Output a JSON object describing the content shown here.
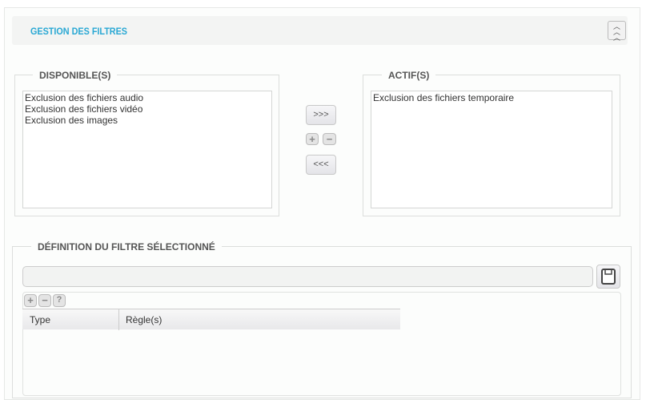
{
  "header": {
    "title": "GESTION DES FILTRES",
    "collapse_icon": "double-chevron-up-icon"
  },
  "available": {
    "legend": "DISPONIBLE(S)",
    "items": [
      "Exclusion des fichiers audio",
      "Exclusion des fichiers vidéo",
      "Exclusion des images"
    ]
  },
  "active": {
    "legend": "ACTIF(S)",
    "items": [
      "Exclusion des fichiers temporaire"
    ]
  },
  "transfer": {
    "add_label": ">>>",
    "remove_label": "<<<",
    "plus": "+",
    "minus": "−"
  },
  "definition": {
    "legend": "DÉFINITION DU FILTRE SÉLECTIONNÉ",
    "name_value": "",
    "toolbar": {
      "add": "+",
      "remove": "−",
      "help": "?"
    },
    "columns": [
      "Type",
      "Règle(s)"
    ]
  }
}
